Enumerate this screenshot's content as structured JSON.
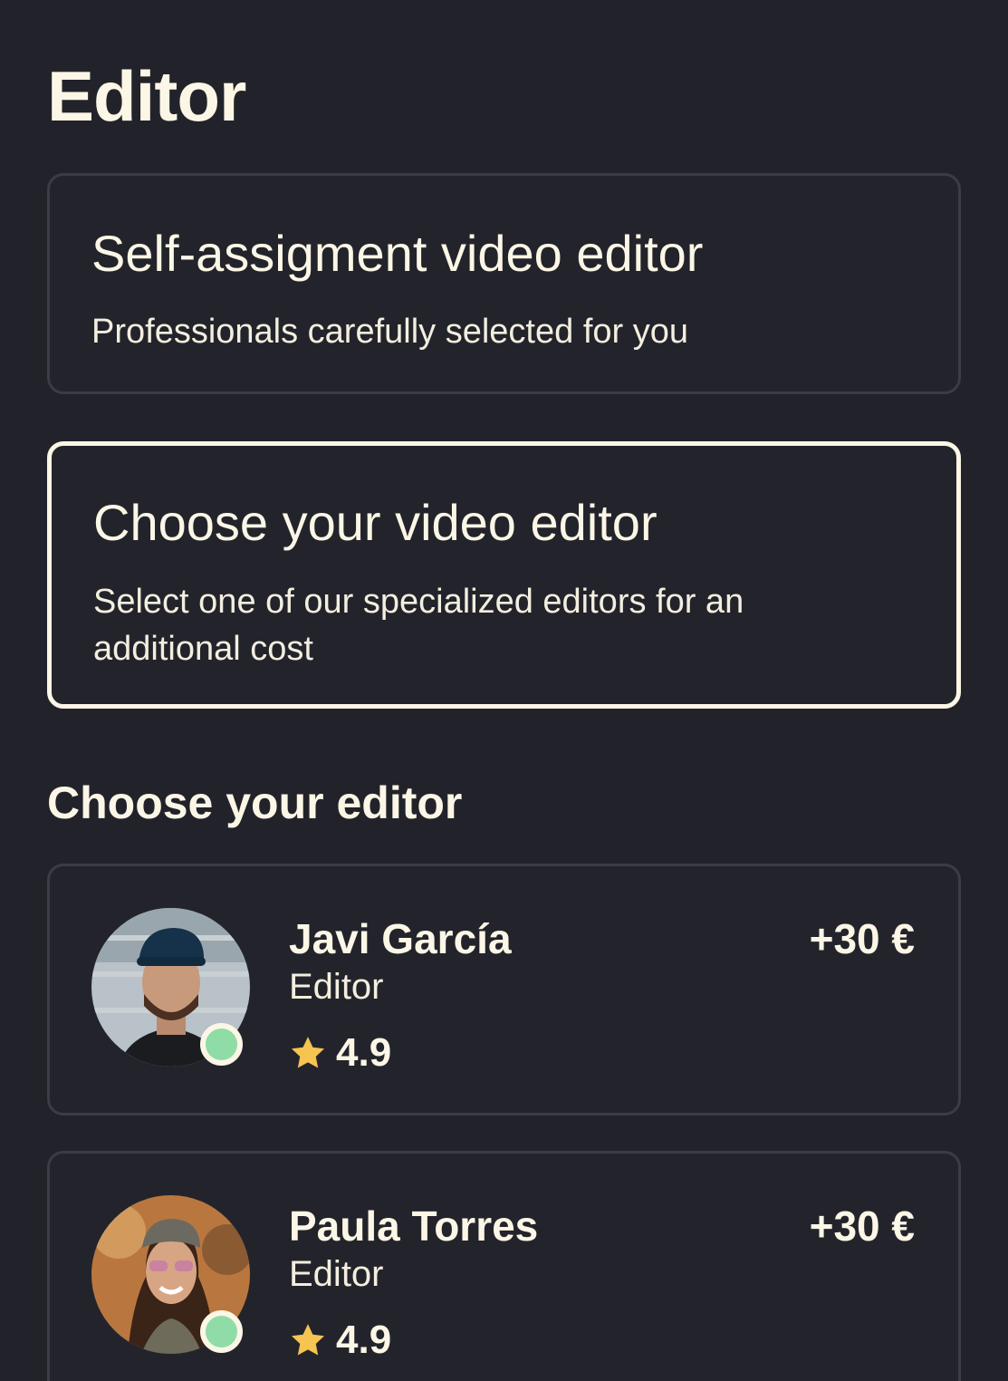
{
  "header": {
    "title": "Editor"
  },
  "options": [
    {
      "title": "Self-assigment video editor",
      "description": "Professionals carefully selected for you",
      "selected": false
    },
    {
      "title": "Choose your video editor",
      "description": "Select one of our specialized editors for an additional cost",
      "selected": true
    }
  ],
  "editors_section": {
    "title": "Choose your editor",
    "editors": [
      {
        "name": "Javi García",
        "role": "Editor",
        "rating": "4.9",
        "price": "+30 €",
        "online": true,
        "rating_icon": "star-icon"
      },
      {
        "name": "Paula Torres",
        "role": "Editor",
        "rating": "4.9",
        "price": "+30 €",
        "online": true,
        "rating_icon": "star-icon"
      }
    ]
  },
  "colors": {
    "background": "#22232a",
    "text": "#fbf6e6",
    "card_border": "#3a3c46",
    "selected_border": "#fbf6e6",
    "online": "#8fdca7",
    "star": "#f5c451"
  }
}
